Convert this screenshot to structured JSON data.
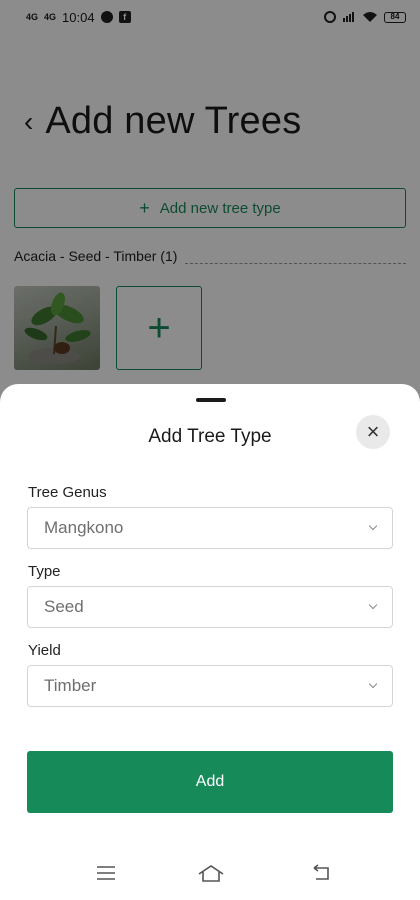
{
  "status_bar": {
    "signal_1": "4G",
    "signal_2": "4G",
    "time": "10:04",
    "battery": "84",
    "icons": [
      "chat-icon",
      "facebook-icon",
      "alarm-icon",
      "volte-icon",
      "wifi-icon",
      "battery-icon"
    ]
  },
  "page": {
    "title": "Add new Trees",
    "add_type_button": "Add new tree type",
    "group_label": "Acacia - Seed - Timber (1)",
    "add_photo_icon": "+"
  },
  "sheet": {
    "title": "Add Tree Type",
    "close_icon": "×",
    "fields": [
      {
        "label": "Tree Genus",
        "value": "Mangkono"
      },
      {
        "label": "Type",
        "value": "Seed"
      },
      {
        "label": "Yield",
        "value": "Timber"
      }
    ],
    "submit_label": "Add"
  },
  "nav_bar": {
    "icons": [
      "menu-icon",
      "home-icon",
      "back-icon"
    ]
  },
  "colors": {
    "accent": "#178a5a",
    "overlay": "rgba(0,0,0,0.45)"
  }
}
